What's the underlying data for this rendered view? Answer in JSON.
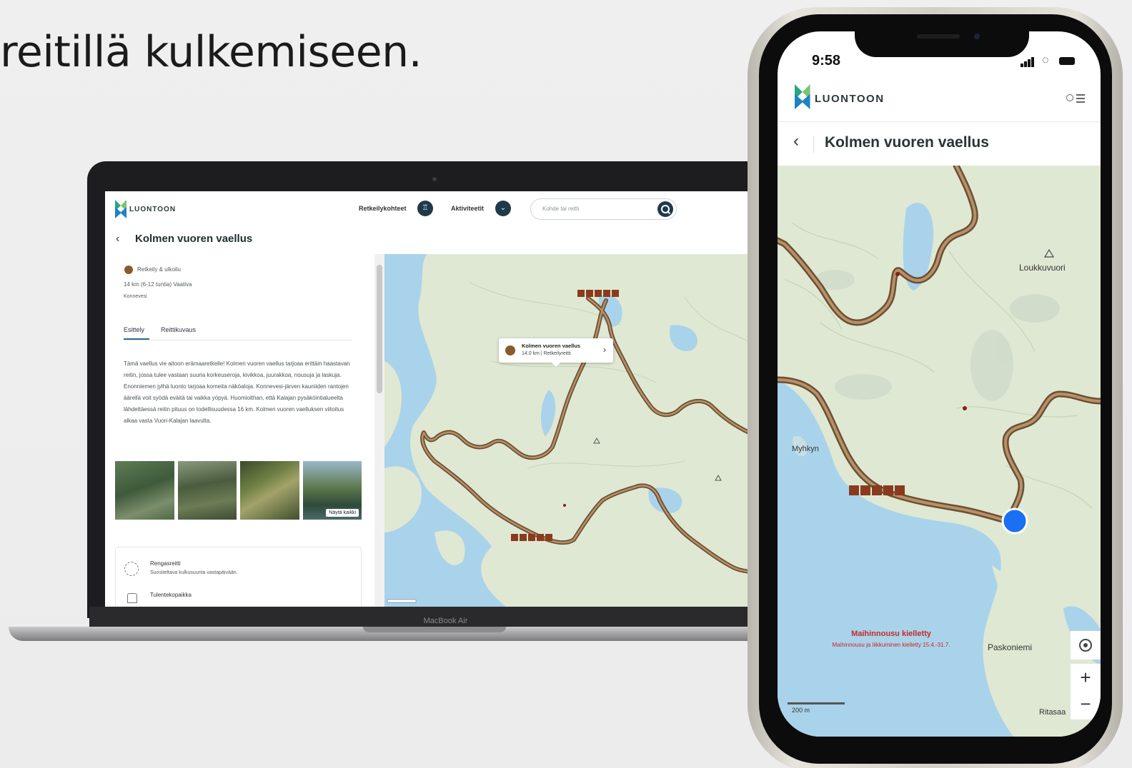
{
  "headline": "reitillä kulkemiseen.",
  "laptop": {
    "brand_label": "MacBook Air",
    "web": {
      "logo_text": "LUONTOON",
      "nav": {
        "destinations_label": "Retkeilykohteet",
        "activities_label": "Aktiviteetit"
      },
      "search_placeholder": "Kohde tai reitti",
      "page_title": "Kolmen vuoren vaellus",
      "category": "Retkeily & ulkoilu",
      "route_meta": "14 km (6-12 tuntia)   Vaativa",
      "location": "Konnevesi",
      "tabs": [
        "Esittely",
        "Reittikuvaus"
      ],
      "description": "Tämä vaellus vie aitoon erämaaretkelle! Kolmen vuoren vaellus tarjoaa erittäin haastavan reitin, jossa tulee vastaan suuria korkeuseroja, kivikkoa, juurakkoa, nousuja ja laskuja. Enonniemen jylhä luonto tarjoaa komeita näköaloja. Konnevesi-järven kauniiden rantojen äärellä voit syödä eväitä tai vaikka yöpyä. Huomioithan, että Kalajan pysäköintialueelta lähdettäessä reitin pituus on todellisuudessa 16 km. Kolmen vuoren vaelluksen viitoitus alkaa vasta Vuori-Kalajan laavulta.",
      "photos_button": "Näytä kaikki",
      "features": [
        {
          "title": "Rengasreitti",
          "subtitle": "Suositeltava kulkusuunta vastapäivään."
        },
        {
          "title": "Tulentekopaikka",
          "subtitle": ""
        }
      ],
      "map_popup": {
        "title": "Kolmen vuoren vaellus",
        "subtitle": "14.0 km | Retkeilyreitti"
      }
    }
  },
  "phone": {
    "time": "9:58",
    "logo_text": "LUONTOON",
    "page_title": "Kolmen vuoren vaellus",
    "map": {
      "labels": {
        "lake": "Loukkuvuori",
        "place_left": "Myhkyn",
        "place_right": "Paskoniemi",
        "place_bottom": "Ritasaa"
      },
      "notice_title": "Maihinnousu kielletty",
      "notice_body": "Maihinnousu ja liikkuminen kielletty 15.4.-31.7.",
      "scale": "200 m"
    }
  },
  "colors": {
    "trail": "#7b5c3a",
    "trail_core": "#b5916a",
    "land": "#dfe8d3",
    "water": "#a9d3ea",
    "brand_dark": "#1f3a4a",
    "location_dot": "#1b6ff2"
  }
}
